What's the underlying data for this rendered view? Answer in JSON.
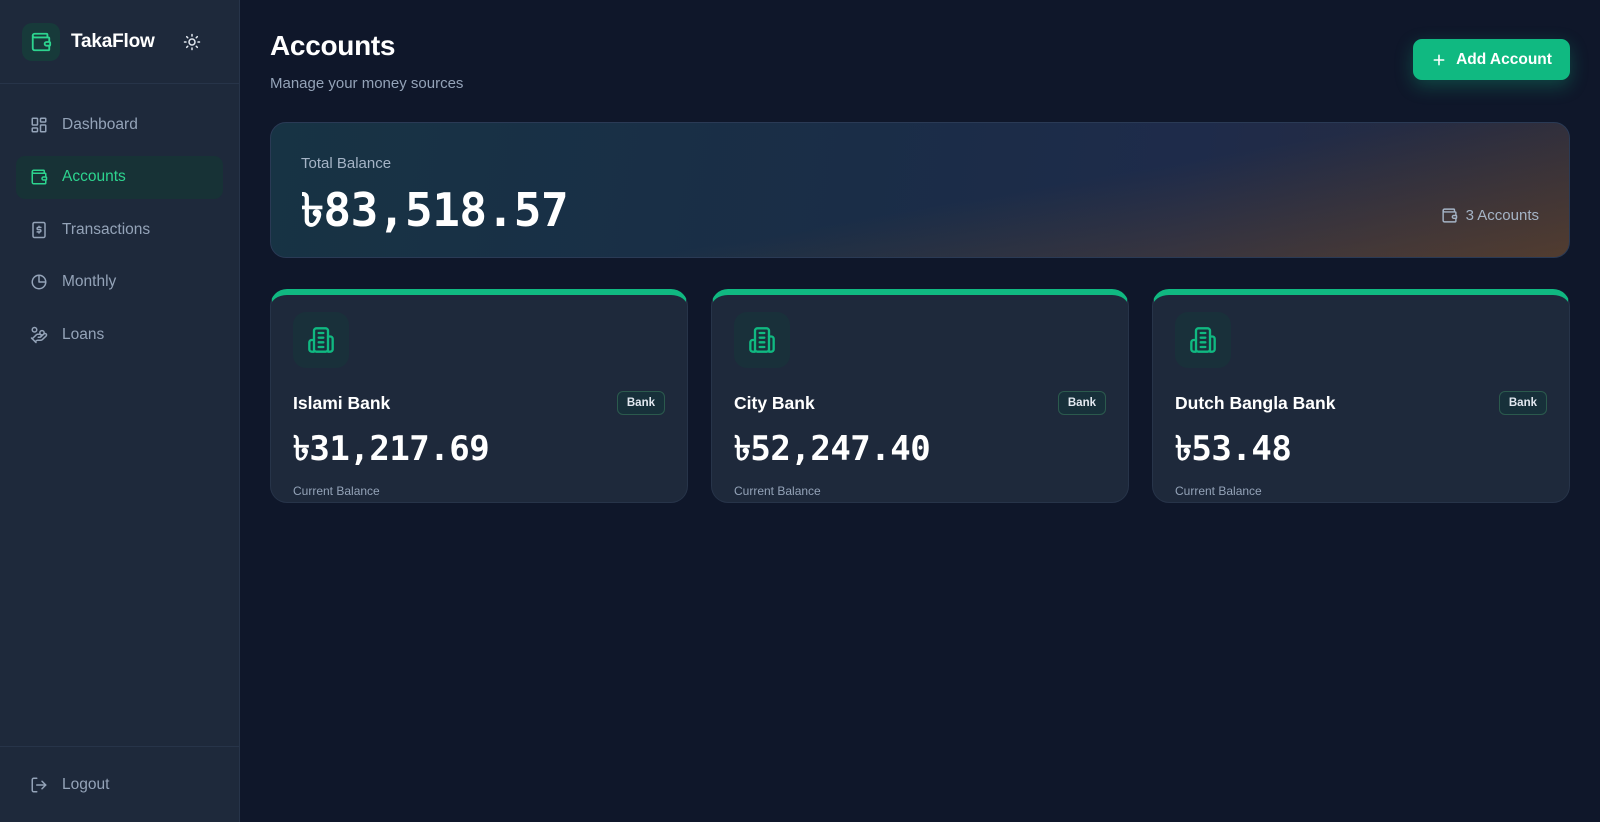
{
  "brand": {
    "name": "TakaFlow"
  },
  "nav": {
    "items": [
      {
        "label": "Dashboard",
        "icon": "dashboard-icon"
      },
      {
        "label": "Accounts",
        "icon": "wallet-icon",
        "active": true
      },
      {
        "label": "Transactions",
        "icon": "receipt-icon"
      },
      {
        "label": "Monthly",
        "icon": "pie-chart-icon"
      },
      {
        "label": "Loans",
        "icon": "hand-coins-icon"
      }
    ],
    "logout_label": "Logout"
  },
  "header": {
    "title": "Accounts",
    "subtitle": "Manage your money sources",
    "add_button_label": "Add Account"
  },
  "summary": {
    "label": "Total Balance",
    "value": "৳83,518.57",
    "count_label": "3 Accounts"
  },
  "accounts": [
    {
      "name": "Islami Bank",
      "type": "Bank",
      "balance": "৳31,217.69",
      "balance_label": "Current Balance"
    },
    {
      "name": "City Bank",
      "type": "Bank",
      "balance": "৳52,247.40",
      "balance_label": "Current Balance"
    },
    {
      "name": "Dutch Bangla Bank",
      "type": "Bank",
      "balance": "৳53.48",
      "balance_label": "Current Balance"
    }
  ],
  "colors": {
    "accent": "#10b981",
    "background": "#0f172a",
    "sidebar": "#1e293b"
  }
}
